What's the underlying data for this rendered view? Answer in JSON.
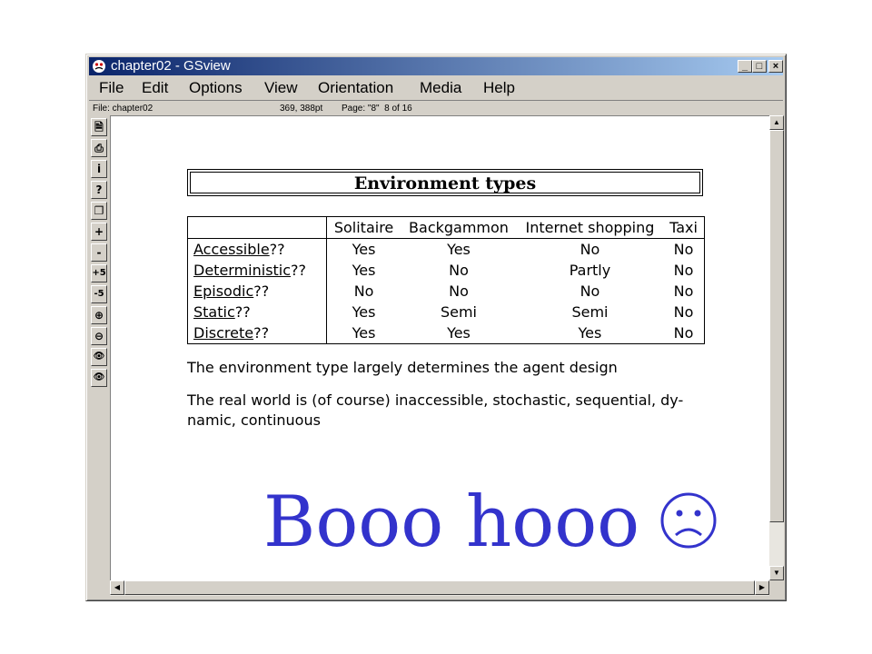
{
  "window": {
    "title": "chapter02 - GSview",
    "min_label": "_",
    "max_label": "□",
    "close_label": "×"
  },
  "menu": [
    {
      "label": "File"
    },
    {
      "label": "Edit"
    },
    {
      "label": "Options"
    },
    {
      "label": "View"
    },
    {
      "label": "Orientation"
    },
    {
      "label": "Media"
    },
    {
      "label": "Help"
    }
  ],
  "status": {
    "file": "File: chapter02",
    "coords": "369, 388pt",
    "page": "Page: \"8\"  8 of 16"
  },
  "toolbar": [
    {
      "name": "open-file-icon",
      "glyph": "🗎"
    },
    {
      "name": "print-icon",
      "glyph": "⎙"
    },
    {
      "name": "info-icon",
      "glyph": "i"
    },
    {
      "name": "help-icon",
      "glyph": "?"
    },
    {
      "name": "copy-icon",
      "glyph": "❐"
    },
    {
      "name": "next-page-icon",
      "glyph": "+"
    },
    {
      "name": "previous-page-icon",
      "glyph": "-"
    },
    {
      "name": "forward-five-icon",
      "glyph": "+5"
    },
    {
      "name": "back-five-icon",
      "glyph": "-5"
    },
    {
      "name": "zoom-in-icon",
      "glyph": "⊕"
    },
    {
      "name": "zoom-out-icon",
      "glyph": "⊖"
    },
    {
      "name": "view-text-icon",
      "glyph": "👁"
    },
    {
      "name": "view-icon",
      "glyph": "👁"
    }
  ],
  "slide": {
    "heading": "Environment types",
    "columns": [
      "",
      "Solitaire",
      "Backgammon",
      "Internet shopping",
      "Taxi"
    ],
    "rows": [
      {
        "label": "Accessible",
        "suffix": "??",
        "values": [
          "Yes",
          "Yes",
          "No",
          "No"
        ]
      },
      {
        "label": "Deterministic",
        "suffix": "??",
        "values": [
          "Yes",
          "No",
          "Partly",
          "No"
        ]
      },
      {
        "label": "Episodic",
        "suffix": "??",
        "values": [
          "No",
          "No",
          "No",
          "No"
        ]
      },
      {
        "label": "Static",
        "suffix": "??",
        "values": [
          "Yes",
          "Semi",
          "Semi",
          "No"
        ]
      },
      {
        "label": "Discrete",
        "suffix": "??",
        "values": [
          "Yes",
          "Yes",
          "Yes",
          "No"
        ]
      }
    ],
    "para1": "The environment type largely determines the agent design",
    "para2_line1": "The real world is (of course) inaccessible, stochastic, sequential, dy-",
    "para2_line2": "namic, continuous",
    "overlay": "Booo hooo",
    "overlay_color": "#3333cc"
  },
  "colors": {
    "titlebar_start": "#0a246a",
    "titlebar_end": "#a6caf0",
    "chrome": "#d4d0c8"
  }
}
